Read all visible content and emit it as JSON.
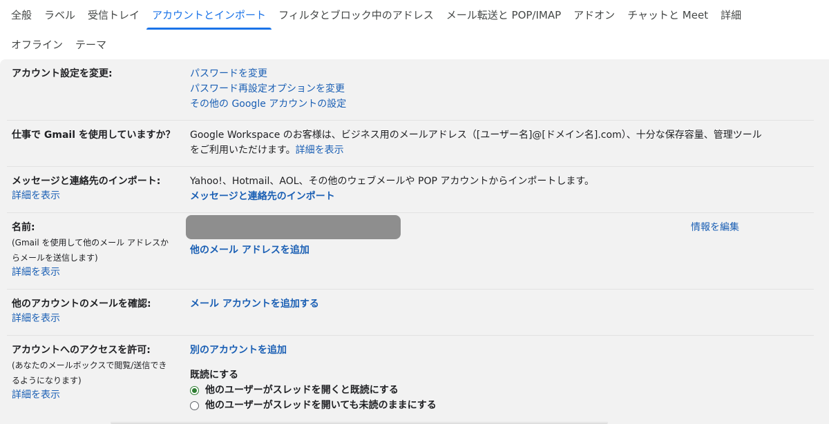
{
  "tabs_row1": [
    {
      "label": "全般"
    },
    {
      "label": "ラベル"
    },
    {
      "label": "受信トレイ"
    },
    {
      "label": "アカウントとインポート",
      "active": true
    },
    {
      "label": "フィルタとブロック中のアドレス"
    },
    {
      "label": "メール転送と POP/IMAP"
    },
    {
      "label": "アドオン"
    },
    {
      "label": "チャットと Meet"
    },
    {
      "label": "詳細"
    }
  ],
  "tabs_row2": [
    {
      "label": "オフライン"
    },
    {
      "label": "テーマ"
    }
  ],
  "account_settings": {
    "title": "アカウント設定を変更:",
    "links": [
      "パスワードを変更",
      "パスワード再設定オプションを変更",
      "その他の Google アカウントの設定"
    ]
  },
  "workspace": {
    "title": "仕事で Gmail を使用していますか？",
    "text_line1": "Google Workspace のお客様は、ビジネス用のメールアドレス（[ユーザー名]@[ドメイン名].com）、十分な保存容量、管理ツール",
    "text_line2": "をご利用いただけます。",
    "link": "詳細を表示"
  },
  "import": {
    "title": "メッセージと連絡先のインポート:",
    "more": "詳細を表示",
    "text": "Yahoo!、Hotmail、AOL、その他のウェブメールや POP アカウントからインポートします。",
    "link": "メッセージと連絡先のインポート"
  },
  "name": {
    "title": "名前:",
    "sub_line1": "(Gmail を使用して他のメール アドレスか",
    "sub_line2": "らメールを送信します)",
    "more": "詳細を表示",
    "add_link": "他のメール アドレスを追加",
    "edit_link": "情報を編集"
  },
  "check_mail": {
    "title": "他のアカウントのメールを確認:",
    "more": "詳細を表示",
    "link": "メール アカウントを追加する"
  },
  "grant_access": {
    "title": "アカウントへのアクセスを許可:",
    "sub_line1": "(あなたのメールボックスで閲覧/送信でき",
    "sub_line2": "るようになります)",
    "more": "詳細を表示",
    "link": "別のアカウントを追加",
    "read_heading": "既読にする",
    "options": [
      {
        "label": "他のユーザーがスレッドを開くと既読にする",
        "selected": true
      },
      {
        "label": "他のユーザーがスレッドを開いても未読のままにする",
        "selected": false
      }
    ]
  },
  "colors": {
    "accent": "#1a73e8",
    "link": "#1a5fb4",
    "panel": "#f2f2f2",
    "radio_on": "#2e7d32"
  }
}
